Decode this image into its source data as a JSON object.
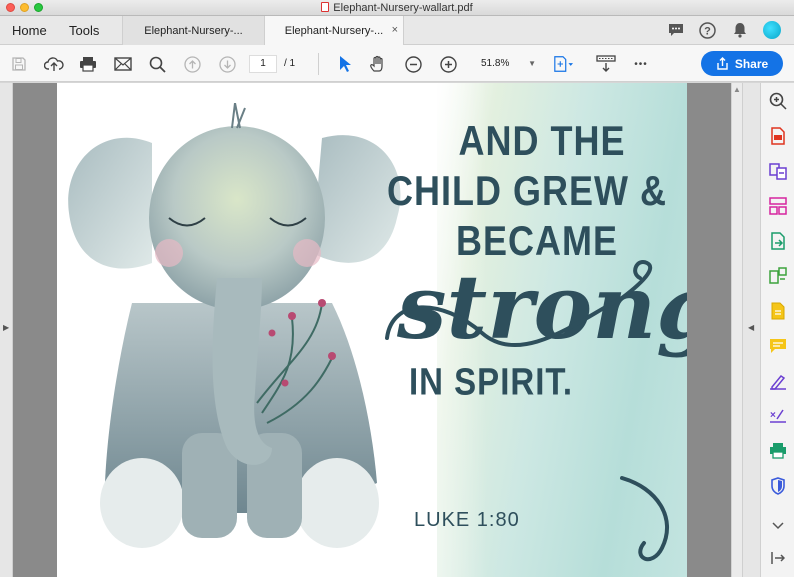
{
  "window": {
    "title": "Elephant-Nursery-wallart.pdf"
  },
  "nav": {
    "home": "Home",
    "tools": "Tools"
  },
  "tabs": [
    {
      "label": "Elephant-Nursery-..."
    },
    {
      "label": "Elephant-Nursery-...",
      "close": "×"
    }
  ],
  "toolbar": {
    "page_current": "1",
    "page_total": "/ 1",
    "zoom": "51.8%",
    "more": "•••",
    "share_label": "Share"
  },
  "document": {
    "line1": "AND THE",
    "line2": "CHILD GREW &",
    "line3": "BECAME",
    "line4": "strong",
    "line5": "IN SPIRIT.",
    "reference": "LUKE 1:80"
  },
  "colors": {
    "accent": "#1473e6",
    "text_dark": "#2e4f5c",
    "wash": "#b6ded9"
  },
  "right_panel_icons": [
    "search-zoom-icon",
    "create-pdf-icon",
    "combine-files-icon",
    "organize-pages-icon",
    "export-pdf-icon",
    "edit-pdf-icon",
    "comment-note-icon",
    "comment-icon",
    "fill-sign-icon",
    "redact-icon",
    "print-production-icon",
    "protect-shield-icon",
    "chevron-down-icon",
    "collapse-panel-icon"
  ]
}
